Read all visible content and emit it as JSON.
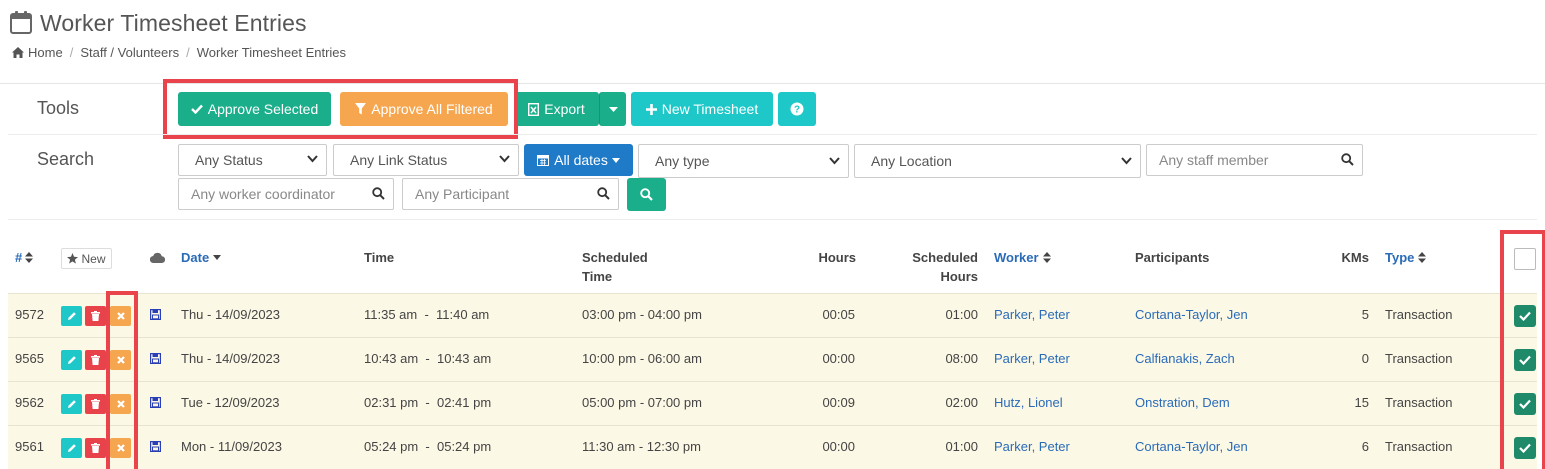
{
  "page": {
    "title": "Worker Timesheet Entries",
    "icon": "calendar-icon"
  },
  "breadcrumb": [
    {
      "label": "Home",
      "icon": "home-icon"
    },
    {
      "label": "Staff / Volunteers"
    },
    {
      "label": "Worker Timesheet Entries"
    }
  ],
  "tools": {
    "label": "Tools",
    "approve_selected": "Approve Selected",
    "approve_all_filtered": "Approve All Filtered",
    "export": "Export",
    "new_timesheet": "New Timesheet"
  },
  "search": {
    "label": "Search",
    "status": "Any Status",
    "link_status": "Any Link Status",
    "dates": "All dates",
    "type": "Any type",
    "location": "Any Location",
    "staff_member_placeholder": "Any staff member",
    "coordinator_placeholder": "Any worker coordinator",
    "participant_placeholder": "Any Participant"
  },
  "table": {
    "headers": {
      "id": "#",
      "new": "New",
      "date": "Date",
      "time": "Time",
      "scheduled_time_1": "Scheduled",
      "scheduled_time_2": "Time",
      "hours": "Hours",
      "scheduled_hours_1": "Scheduled",
      "scheduled_hours_2": "Hours",
      "worker": "Worker",
      "participants": "Participants",
      "kms": "KMs",
      "type": "Type"
    },
    "rows": [
      {
        "id": "9572",
        "date": "Thu - 14/09/2023",
        "time": "11:35 am  -  11:40 am",
        "scheduled": "03:00 pm - 04:00 pm",
        "hours": "00:05",
        "scheduled_hours": "01:00",
        "worker": "Parker, Peter",
        "participant": "Cortana-Taylor, Jen",
        "kms": "5",
        "type": "Transaction",
        "checked": true
      },
      {
        "id": "9565",
        "date": "Thu - 14/09/2023",
        "time": "10:43 am  -  10:43 am",
        "scheduled": "10:00 pm - 06:00 am",
        "hours": "00:00",
        "scheduled_hours": "08:00",
        "worker": "Parker, Peter",
        "participant": "Calfianakis, Zach",
        "kms": "0",
        "type": "Transaction",
        "checked": true
      },
      {
        "id": "9562",
        "date": "Tue - 12/09/2023",
        "time": "02:31 pm  -  02:41 pm",
        "scheduled": "05:00 pm - 07:00 pm",
        "hours": "00:09",
        "scheduled_hours": "02:00",
        "worker": "Hutz, Lionel",
        "participant": "Onstration, Dem",
        "kms": "15",
        "type": "Transaction",
        "checked": true
      },
      {
        "id": "9561",
        "date": "Mon - 11/09/2023",
        "time": "05:24 pm  -  05:24 pm",
        "scheduled": "11:30 am - 12:30 pm",
        "hours": "00:00",
        "scheduled_hours": "01:00",
        "worker": "Parker, Peter",
        "participant": "Cortana-Taylor, Jen",
        "kms": "6",
        "type": "Transaction",
        "checked": true
      }
    ]
  },
  "colors": {
    "green": "#1aae8a",
    "orange": "#f5a64f",
    "teal": "#1ec8c8",
    "blue": "#1f7ac8",
    "red": "#e8434b",
    "highlight": "#e9434b",
    "row_bg": "#fcf8e6"
  }
}
